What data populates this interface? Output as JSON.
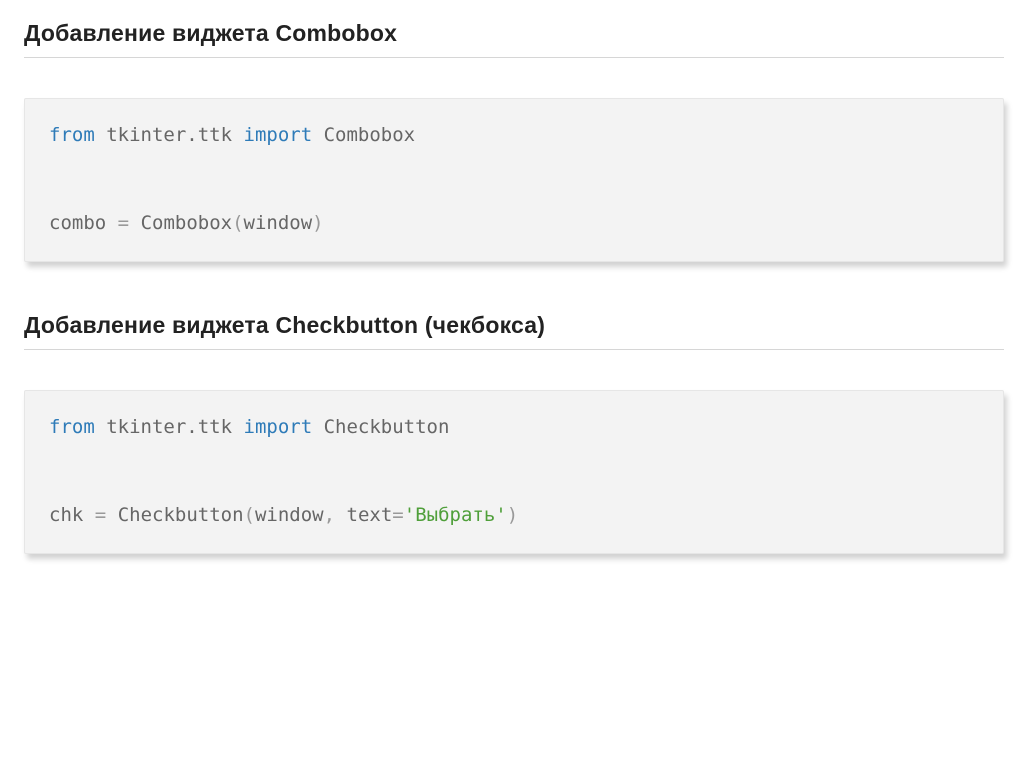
{
  "sections": [
    {
      "heading": "Добавление виджета Combobox",
      "code": {
        "line1": {
          "from": "from",
          "module": "tkinter.ttk",
          "import": "import",
          "name": "Combobox"
        },
        "line2": {
          "lhs": "combo",
          "eq": "=",
          "call": "Combobox",
          "lp": "(",
          "arg": "window",
          "rp": ")"
        }
      }
    },
    {
      "heading": "Добавление виджета Checkbutton (чекбокса)",
      "code": {
        "line1": {
          "from": "from",
          "module": "tkinter.ttk",
          "import": "import",
          "name": "Checkbutton"
        },
        "line2": {
          "lhs": "chk",
          "eq": "=",
          "call": "Checkbutton",
          "lp": "(",
          "arg1": "window",
          "comma": ",",
          "kwarg": "text",
          "assign": "=",
          "str": "'Выбрать'",
          "rp": ")"
        }
      }
    }
  ]
}
